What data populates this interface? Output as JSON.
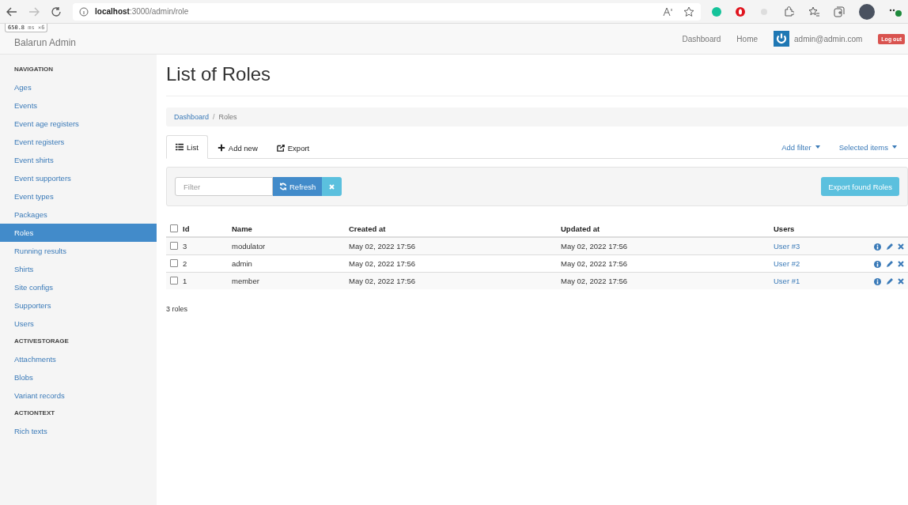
{
  "browser": {
    "url_host": "localhost",
    "url_path": ":3000/admin/role"
  },
  "profiler": {
    "time": "650.8",
    "unit": "ms",
    "count": "×6"
  },
  "navbar": {
    "brand": "Balarun Admin",
    "links": [
      "Dashboard",
      "Home"
    ],
    "user": "admin@admin.com",
    "logout": "Log out"
  },
  "sidebar": {
    "sections": [
      {
        "heading": "NAVIGATION",
        "items": [
          {
            "label": "Ages",
            "selected": false
          },
          {
            "label": "Events",
            "selected": false
          },
          {
            "label": "Event age registers",
            "selected": false
          },
          {
            "label": "Event registers",
            "selected": false
          },
          {
            "label": "Event shirts",
            "selected": false
          },
          {
            "label": "Event supporters",
            "selected": false
          },
          {
            "label": "Event types",
            "selected": false
          },
          {
            "label": "Packages",
            "selected": false
          },
          {
            "label": "Roles",
            "selected": true
          },
          {
            "label": "Running results",
            "selected": false
          },
          {
            "label": "Shirts",
            "selected": false
          },
          {
            "label": "Site configs",
            "selected": false
          },
          {
            "label": "Supporters",
            "selected": false
          },
          {
            "label": "Users",
            "selected": false
          }
        ]
      },
      {
        "heading": "ACTIVESTORAGE",
        "items": [
          {
            "label": "Attachments",
            "selected": false
          },
          {
            "label": "Blobs",
            "selected": false
          },
          {
            "label": "Variant records",
            "selected": false
          }
        ]
      },
      {
        "heading": "ACTIONTEXT",
        "items": [
          {
            "label": "Rich texts",
            "selected": false
          }
        ]
      }
    ]
  },
  "page": {
    "title": "List of Roles",
    "breadcrumb": [
      "Dashboard",
      "Roles"
    ],
    "breadcrumb_separator": "/",
    "tabs": [
      {
        "label": "List",
        "kind": "list",
        "selected": true
      },
      {
        "label": "Add new",
        "kind": "add",
        "selected": false
      },
      {
        "label": "Export",
        "kind": "export",
        "selected": false
      }
    ],
    "menus": [
      "Add filter",
      "Selected items"
    ],
    "filter": {
      "placeholder": "Filter",
      "refresh": "Refresh",
      "export": "Export found Roles"
    },
    "table": {
      "columns": [
        "Id",
        "Name",
        "Created at",
        "Updated at",
        "Users"
      ],
      "all_checked": false,
      "rows": [
        {
          "id": "3",
          "name": "modulator",
          "created": "May 02, 2022 17:56",
          "updated": "May 02, 2022 17:56",
          "users": "User #3",
          "checked": false
        },
        {
          "id": "2",
          "name": "admin",
          "created": "May 02, 2022 17:56",
          "updated": "May 02, 2022 17:56",
          "users": "User #2",
          "checked": false
        },
        {
          "id": "1",
          "name": "member",
          "created": "May 02, 2022 17:56",
          "updated": "May 02, 2022 17:56",
          "users": "User #1",
          "checked": false
        }
      ]
    },
    "count": "3 roles"
  }
}
